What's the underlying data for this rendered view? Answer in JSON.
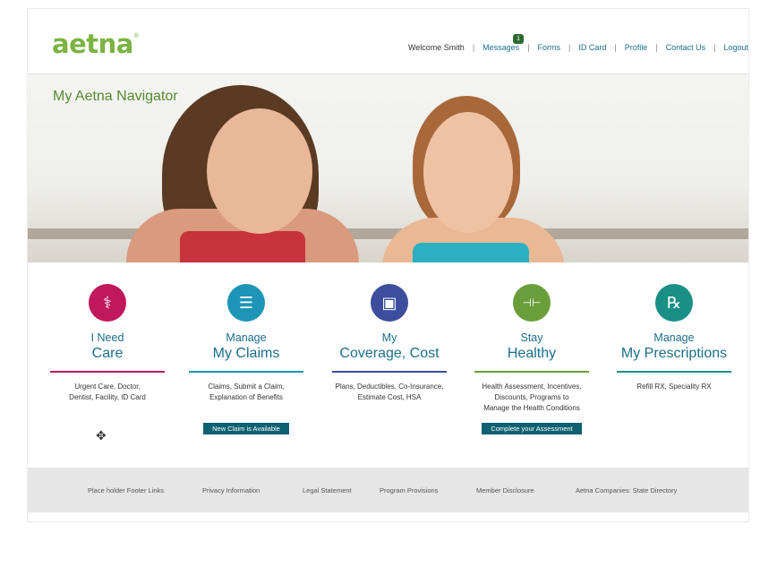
{
  "header": {
    "logo": "aetna",
    "logo_mark": "®",
    "welcome": "Welcome Smith",
    "messages_label": "Messages",
    "messages_count": "1",
    "nav": [
      "Forms",
      "ID Card",
      "Profile",
      "Contact Us",
      "Logout"
    ]
  },
  "hero": {
    "title": "My Aetna Navigator"
  },
  "tiles": [
    {
      "line1": "I Need",
      "line2": "Care",
      "icon": "stethoscope-icon",
      "color": "#c0185c",
      "desc": [
        "Urgent Care, Doctor,",
        "Dentist, Facility, ID Card"
      ],
      "cta": ""
    },
    {
      "line1": "Manage",
      "line2": "My Claims",
      "icon": "clipboard-icon",
      "color": "#1e95b6",
      "desc": [
        "Claims, Submit a Claim,",
        "Explanation of Benefits"
      ],
      "cta": "New Claim is Available"
    },
    {
      "line1": "My",
      "line2": "Coverage, Cost",
      "icon": "id-card-icon",
      "color": "#3d4e9e",
      "desc": [
        "Plans, Deductibles, Co-Insurance,",
        "Estimate Cost, HSA"
      ],
      "cta": ""
    },
    {
      "line1": "Stay",
      "line2": "Healthy",
      "icon": "dumbbell-icon",
      "color": "#6a9e3a",
      "desc": [
        "Health Assessment, Incentives,",
        "Discounts, Programs to",
        "Manage the Health Conditions"
      ],
      "cta": "Complete your Assessment"
    },
    {
      "line1": "Manage",
      "line2": "My Prescriptions",
      "icon": "rx-icon",
      "color": "#1a8f86",
      "desc": [
        "Refill RX, Speciality RX"
      ],
      "cta": ""
    }
  ],
  "icon_glyphs": {
    "stethoscope": "⚕",
    "clipboard": "☰",
    "idcard": "▣",
    "dumbbell": "⊣⊢",
    "rx": "℞"
  },
  "footer": {
    "links": [
      "Place holder Footer Links",
      "Privacy Information",
      "Legal Statement",
      "Program Provisions",
      "Member Disclosure",
      "Aetna Companies: State Directory"
    ]
  },
  "cursor": "✥"
}
